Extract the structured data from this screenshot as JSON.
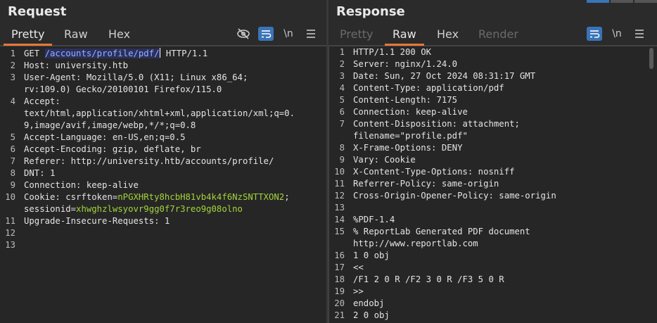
{
  "request": {
    "title": "Request",
    "tabs": [
      "Pretty",
      "Raw",
      "Hex"
    ],
    "active_tab": "Pretty",
    "tool_newline": "\\n",
    "lines": [
      {
        "n": "1",
        "parts": [
          {
            "t": "GET "
          },
          {
            "t": "/accounts/profile/pdf/",
            "c": "hl"
          },
          {
            "cursor": true
          },
          {
            "t": " HTTP/1.1"
          }
        ]
      },
      {
        "n": "2",
        "parts": [
          {
            "t": "Host: university.htb"
          }
        ]
      },
      {
        "n": "3",
        "parts": [
          {
            "t": "User-Agent: Mozilla/5.0 (X11; Linux x86_64;"
          }
        ]
      },
      {
        "n": "",
        "parts": [
          {
            "t": "rv:109.0) Gecko/20100101 Firefox/115.0"
          }
        ]
      },
      {
        "n": "4",
        "parts": [
          {
            "t": "Accept:"
          }
        ]
      },
      {
        "n": "",
        "parts": [
          {
            "t": "text/html,application/xhtml+xml,application/xml;q=0."
          }
        ]
      },
      {
        "n": "",
        "parts": [
          {
            "t": "9,image/avif,image/webp,*/*;q=0.8"
          }
        ]
      },
      {
        "n": "5",
        "parts": [
          {
            "t": "Accept-Language: en-US,en;q=0.5"
          }
        ]
      },
      {
        "n": "6",
        "parts": [
          {
            "t": "Accept-Encoding: gzip, deflate, br"
          }
        ]
      },
      {
        "n": "7",
        "parts": [
          {
            "t": "Referer: http://university.htb/accounts/profile/"
          }
        ]
      },
      {
        "n": "8",
        "parts": [
          {
            "t": "DNT: 1"
          }
        ]
      },
      {
        "n": "9",
        "parts": [
          {
            "t": "Connection: keep-alive"
          }
        ]
      },
      {
        "n": "10",
        "parts": [
          {
            "t": "Cookie: csrftoken="
          },
          {
            "t": "nPGXHRty8hcbH81vb4k4f6NzSNTTXON2",
            "c": "val"
          },
          {
            "t": ";"
          }
        ]
      },
      {
        "n": "",
        "parts": [
          {
            "t": "sessionid="
          },
          {
            "t": "xhwghzlwsyovr9gg0f7r3reo9g08olno",
            "c": "val"
          }
        ]
      },
      {
        "n": "11",
        "parts": [
          {
            "t": "Upgrade-Insecure-Requests: 1"
          }
        ]
      },
      {
        "n": "12",
        "parts": []
      },
      {
        "n": "13",
        "parts": []
      }
    ]
  },
  "response": {
    "title": "Response",
    "tabs": [
      "Pretty",
      "Raw",
      "Hex",
      "Render"
    ],
    "active_tab": "Raw",
    "disabled_tabs": [
      "Pretty",
      "Render"
    ],
    "tool_newline": "\\n",
    "lines": [
      {
        "n": "1",
        "parts": [
          {
            "t": "HTTP/1.1 200 OK"
          }
        ]
      },
      {
        "n": "2",
        "parts": [
          {
            "t": "Server: nginx/1.24.0"
          }
        ]
      },
      {
        "n": "3",
        "parts": [
          {
            "t": "Date: Sun, 27 Oct 2024 08:31:17 GMT"
          }
        ]
      },
      {
        "n": "4",
        "parts": [
          {
            "t": "Content-Type: application/pdf"
          }
        ]
      },
      {
        "n": "5",
        "parts": [
          {
            "t": "Content-Length: 7175"
          }
        ]
      },
      {
        "n": "6",
        "parts": [
          {
            "t": "Connection: keep-alive"
          }
        ]
      },
      {
        "n": "7",
        "parts": [
          {
            "t": "Content-Disposition: attachment;"
          }
        ]
      },
      {
        "n": "",
        "parts": [
          {
            "t": "filename=\"profile.pdf\""
          }
        ]
      },
      {
        "n": "8",
        "parts": [
          {
            "t": "X-Frame-Options: DENY"
          }
        ]
      },
      {
        "n": "9",
        "parts": [
          {
            "t": "Vary: Cookie"
          }
        ]
      },
      {
        "n": "10",
        "parts": [
          {
            "t": "X-Content-Type-Options: nosniff"
          }
        ]
      },
      {
        "n": "11",
        "parts": [
          {
            "t": "Referrer-Policy: same-origin"
          }
        ]
      },
      {
        "n": "12",
        "parts": [
          {
            "t": "Cross-Origin-Opener-Policy: same-origin"
          }
        ]
      },
      {
        "n": "13",
        "parts": []
      },
      {
        "n": "14",
        "parts": [
          {
            "t": "%PDF-1.4"
          }
        ]
      },
      {
        "n": "15",
        "parts": [
          {
            "t": "% ReportLab Generated PDF document"
          }
        ]
      },
      {
        "n": "",
        "parts": [
          {
            "t": "http://www.reportlab.com"
          }
        ]
      },
      {
        "n": "16",
        "parts": [
          {
            "t": "1 0 obj"
          }
        ]
      },
      {
        "n": "17",
        "parts": [
          {
            "t": "<<"
          }
        ]
      },
      {
        "n": "18",
        "parts": [
          {
            "t": "/F1 2 0 R /F2 3 0 R /F3 5 0 R"
          }
        ]
      },
      {
        "n": "19",
        "parts": [
          {
            "t": ">>"
          }
        ]
      },
      {
        "n": "20",
        "parts": [
          {
            "t": "endobj"
          }
        ]
      },
      {
        "n": "21",
        "parts": [
          {
            "t": "2 0 obj"
          }
        ]
      }
    ]
  },
  "colors": {
    "accent_tab": "#e8773a",
    "toggle_on": "#3a74b8",
    "highlight_bg": "#2d2f5c",
    "cookie_value": "#a3d33b"
  }
}
